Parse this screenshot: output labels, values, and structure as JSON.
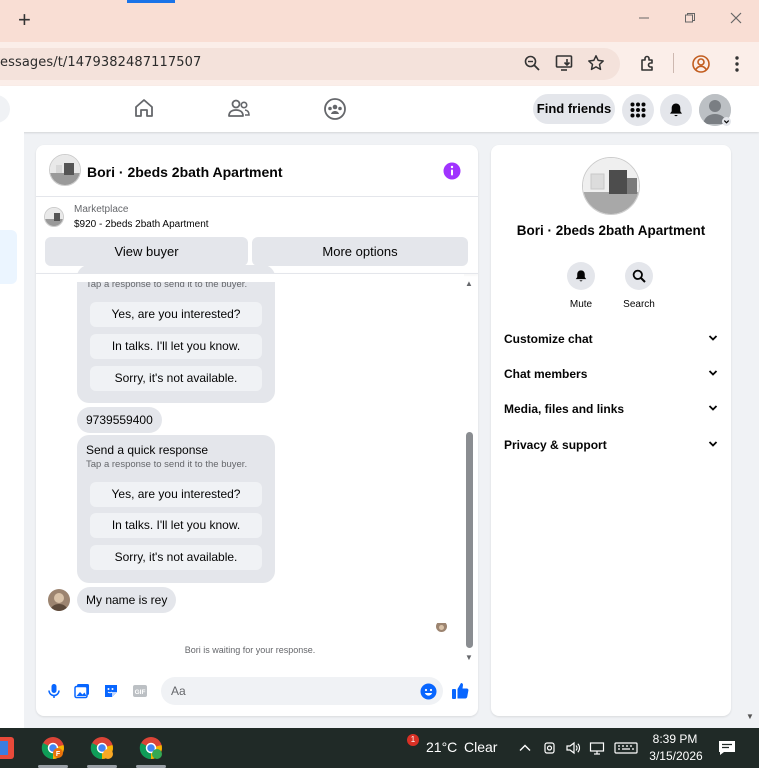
{
  "browser": {
    "url": "essages/t/1479382487117507",
    "new_tab_label": "+"
  },
  "fb_header": {
    "find_friends_label": "Find friends"
  },
  "chat": {
    "title": "Bori · 2beds 2bath Apartment",
    "marketplace_label": "Marketplace",
    "marketplace_detail": "$920 - 2beds 2bath Apartment",
    "view_buyer_label": "View buyer",
    "more_options_label": "More options",
    "quick_response_1": {
      "subtitle": "Tap a response to send it to the buyer.",
      "options": [
        "Yes, are you interested?",
        "In talks. I'll let you know.",
        "Sorry, it's not available."
      ]
    },
    "phone_message": "9739559400",
    "quick_response_2": {
      "title": "Send a quick response",
      "subtitle": "Tap a response to send it to the buyer.",
      "options": [
        "Yes, are you interested?",
        "In talks. I'll let you know.",
        "Sorry, it's not available."
      ]
    },
    "last_message": "My name is rey",
    "waiting_text": "Bori is waiting for your response.",
    "composer_placeholder": "Aa"
  },
  "info_panel": {
    "title": "Bori · 2beds 2bath Apartment",
    "actions": [
      {
        "label": "Mute",
        "icon": "bell-icon"
      },
      {
        "label": "Search",
        "icon": "search-icon"
      }
    ],
    "sections": [
      "Customize chat",
      "Chat members",
      "Media, files and links",
      "Privacy & support"
    ]
  },
  "taskbar": {
    "weather_temp": "21°C",
    "weather_desc": "Clear",
    "time": "8:39 PM",
    "date": "3/15/2026",
    "badge_count": "1"
  },
  "colors": {
    "messenger_blue": "#0866ff",
    "info_purple": "#a033ff",
    "titlebar": "#f9ded4",
    "taskbar": "#202a27"
  }
}
